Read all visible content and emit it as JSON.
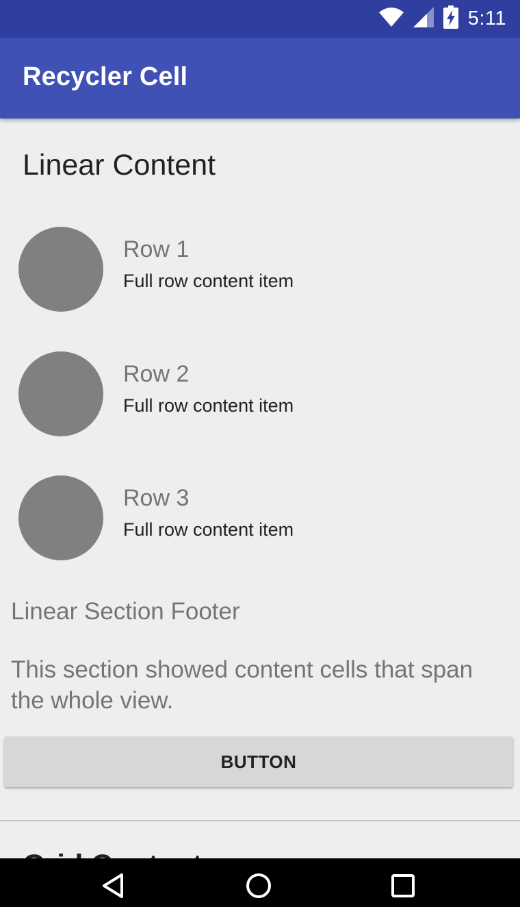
{
  "status_bar": {
    "time": "5:11",
    "icons": [
      "wifi-icon",
      "cell-signal-icon",
      "battery-charging-icon"
    ]
  },
  "app_bar": {
    "title": "Recycler Cell"
  },
  "linear_section": {
    "header": "Linear Content",
    "rows": [
      {
        "title": "Row 1",
        "subtitle": "Full row content item"
      },
      {
        "title": "Row 2",
        "subtitle": "Full row content item"
      },
      {
        "title": "Row 3",
        "subtitle": "Full row content item"
      }
    ],
    "footer_title": "Linear Section Footer",
    "footer_description": "This section showed content cells that span the whole view.",
    "button_label": "BUTTON"
  },
  "next_section": {
    "header": "Grid Content"
  },
  "nav_bar": {
    "icons": [
      "back-icon",
      "home-icon",
      "recents-icon"
    ]
  },
  "colors": {
    "status_bar": "#303f9f",
    "app_bar": "#3f51b5",
    "background": "#eeeeee",
    "avatar": "#808080",
    "button": "#d6d7d7"
  }
}
